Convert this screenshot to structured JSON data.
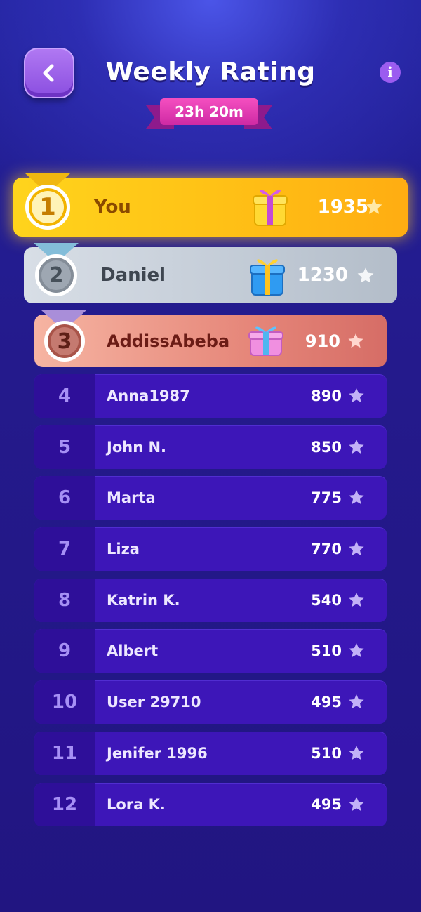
{
  "header": {
    "title": "Weekly Rating",
    "timer": "23h 20m",
    "info_label": "i"
  },
  "top": [
    {
      "rank": "1",
      "name": "You",
      "score": "1935"
    },
    {
      "rank": "2",
      "name": "Daniel",
      "score": "1230"
    },
    {
      "rank": "3",
      "name": "AddissAbeba",
      "score": "910"
    }
  ],
  "list": [
    {
      "rank": "4",
      "name": "Anna1987",
      "score": "890"
    },
    {
      "rank": "5",
      "name": "John N.",
      "score": "850"
    },
    {
      "rank": "6",
      "name": "Marta",
      "score": "775"
    },
    {
      "rank": "7",
      "name": "Liza",
      "score": "770"
    },
    {
      "rank": "8",
      "name": "Katrin K.",
      "score": "540"
    },
    {
      "rank": "9",
      "name": "Albert",
      "score": "510"
    },
    {
      "rank": "10",
      "name": "User 29710",
      "score": "495"
    },
    {
      "rank": "11",
      "name": "Jenifer 1996",
      "score": "510"
    },
    {
      "rank": "12",
      "name": "Lora K.",
      "score": "495"
    }
  ],
  "colors": {
    "background": "#22198f",
    "gold": "#ffc216",
    "silver": "#c2cbd6",
    "bronze": "#e6877a",
    "row": "#3d16b8",
    "timer": "#e23db3"
  },
  "icons": {
    "back": "chevron-left-icon",
    "info": "info-icon",
    "score": "star-icon",
    "reward": "gift-icon"
  }
}
